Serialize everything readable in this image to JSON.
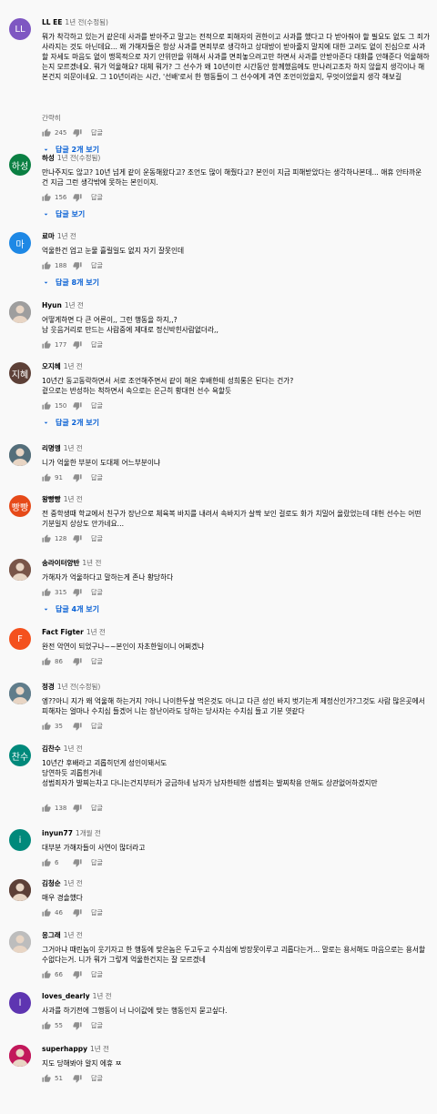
{
  "labels": {
    "reply": "답글",
    "read_more": "간략히"
  },
  "colors": {
    "link": "#065fd4",
    "text": "#030303",
    "meta": "#606060"
  },
  "comments": [
    {
      "author": "LL EE",
      "time": "1년 전(수정됨)",
      "avatar_text": "LL",
      "avatar_color": "#7e57c2",
      "avatar_icon": "",
      "text": "뭐가 착각하고 있는거 같은데 사과를 받아주고 말고는 전적으로 피해자의 권한이고 사과를 했다고 다 받아줘야 할 필요도 없도 그 죄가 사라지는 것도 아닌데요... 왜 가해자들은 항상 사과를 면죄부로 생각하고 상대방이 받아줄지 말지에 대한 고려도 없이 진심으로 사과할 자세도 마음도 없이 맹목적으로 자기 안위만을 위해서 사과를 면죄놓으려고만 하면서 사과를 안받아준다 대화를 안해준다 억울해하는지 모르겠네요. 뭐가 억울해요? 대체 뭐가? 그 선수가 왜 10년이란 시간동안 함께했음에도 만나려고조차 하지 않을지 생각이나 해본건지 의문이네요. 그 10년이라는 시간, '선배'로서 한 행동들이 그 선수에게 과연 조언이었을지, 무엇이었을지 생각 해보길",
      "likes": "245",
      "replies": "답글 2개 보기"
    },
    {
      "author": "하성",
      "time": "1년 전(수정됨)",
      "avatar_text": "하성",
      "avatar_color": "#0b8043",
      "avatar_icon": "",
      "text": "만나주지도 않고? 10년 넘게 같이 운동해왔다고? 조언도 많이 해줬다고? 본인이 지금 피해받았다는 생각하나본데... 애휴 안타까운 건 지금 그런 생각밖에 못하는 본인이지.",
      "likes": "156",
      "replies": "답글 보기"
    },
    {
      "author": "료마",
      "time": "1년 전",
      "avatar_text": "마",
      "avatar_color": "#1e88e5",
      "avatar_icon": "",
      "text": "억울한건 업고 눈물 흘릴일도 없지 자기 잘못인데",
      "likes": "188",
      "replies": "답글 8개 보기"
    },
    {
      "author": "Hyun",
      "time": "1년 전",
      "avatar_text": "",
      "avatar_color": "#9e9e9e",
      "avatar_icon": "photo-avatar",
      "text": "어떻게하면 다 큰 어른이,, 그런 행동을 하지,,?\n남 웃음거리로 만드는 사람중에 제대로 정신박힌사람없더라,,",
      "likes": "177",
      "replies": ""
    },
    {
      "author": "오지혜",
      "time": "1년 전",
      "avatar_text": "지혜",
      "avatar_color": "#5d4037",
      "avatar_icon": "",
      "text": "10년간 동고동락하면서 서로 조언해주면서 같이 해온 후배한테 성희롱은 된다는 건가?\n겉으로는 반성하는 척하면서 속으로는 은근히 황대헌 선수 욕할듯",
      "likes": "150",
      "replies": "답글 2개 보기"
    },
    {
      "author": "리명멩",
      "time": "1년 전",
      "avatar_text": "",
      "avatar_color": "#546e7a",
      "avatar_icon": "photo-avatar",
      "text": "니가 억울한 부분이 도대체 어느부분이냐",
      "likes": "91",
      "replies": ""
    },
    {
      "author": "왕빵빵",
      "time": "1년 전",
      "avatar_text": "빵빵",
      "avatar_color": "#e64a19",
      "avatar_icon": "",
      "text": "전 중학생때 학교에서 친구가 장난으로 체육복 바지를 내려서 속바지가 살짝 보인 걸로도 화가 치밀어 올랐었는데 대헌 선수는 어떤 기분일지 상상도 안가네요...",
      "likes": "128",
      "replies": ""
    },
    {
      "author": "송라이터양반",
      "time": "1년 전",
      "avatar_text": "",
      "avatar_color": "#795548",
      "avatar_icon": "photo-avatar",
      "text": "가해자가 억울하다고 말하는게 존나 황당하다",
      "likes": "315",
      "replies": "답글 4개 보기"
    },
    {
      "author": "Fact Figter",
      "time": "1년 전",
      "avatar_text": "F",
      "avatar_color": "#f4511e",
      "avatar_icon": "",
      "text": "완전 악연이 되었구나~~본인이 자초한일이니 어쩌겠냐",
      "likes": "86",
      "replies": ""
    },
    {
      "author": "정경",
      "time": "1년 전(수정됨)",
      "avatar_text": "",
      "avatar_color": "#607d8b",
      "avatar_icon": "photo-avatar",
      "text": "엥??아니 지가 왜 억울해 하는거지 ?아니 나이한두살 먹은것도 아니고 다큰 성인 바지 벗기는게 제정신인가?그것도 사람 많은곳에서 피해자는 얼마나 수치심 들겠어 니는 장난이라도 당하는 당사자는 수치심 들고 기분 엿같다",
      "likes": "35",
      "replies": ""
    },
    {
      "author": "김찬수",
      "time": "1년 전",
      "avatar_text": "찬수",
      "avatar_color": "#00897b",
      "avatar_icon": "",
      "text": "10년간 후배라고 괴롭히던게 성인이돼서도\n당연하듯 괴롭힌거네\n성범죄자가 발찌는차고 다니는건지부터가 궁금하네 남자가 남자한테한 성범죄는 발찌착용 안해도 상관없어하겠지만",
      "likes": "138",
      "replies": ""
    },
    {
      "author": "inyun77",
      "time": "1개월 전",
      "avatar_text": "i",
      "avatar_color": "#00897b",
      "avatar_icon": "",
      "text": "대부분 가해자들이 사연이 많더라고",
      "likes": "6",
      "replies": ""
    },
    {
      "author": "김청순",
      "time": "1년 전",
      "avatar_text": "",
      "avatar_color": "#5d4037",
      "avatar_icon": "photo-avatar",
      "text": "매우 경솔했다",
      "likes": "46",
      "replies": ""
    },
    {
      "author": "응그래",
      "time": "1년 전",
      "avatar_text": "",
      "avatar_color": "#bdbdbd",
      "avatar_icon": "photo-avatar",
      "text": "그거아냐 때린놈이 웃기자고 한 행동에 맞은놈은 두고두고 수치심에 방장못이루고 괴롭다는거... 말로는 용서해도 마음으로는 용서할수없다는거. 니가 뭐가 그렇게 억울한건지는 잘 모르겠네",
      "likes": "66",
      "replies": ""
    },
    {
      "author": "loves_dearly",
      "time": "1년 전",
      "avatar_text": "l",
      "avatar_color": "#5e35b1",
      "avatar_icon": "",
      "text": "사과를 하기전에 그행동이 너 나이값에 맞는 행동인지 묻고싶다.",
      "likes": "55",
      "replies": ""
    },
    {
      "author": "superhappy",
      "time": "1년 전",
      "avatar_text": "",
      "avatar_color": "#c2185b",
      "avatar_icon": "photo-avatar",
      "text": "지도 당해봐야 알지 에휴 ㅉ",
      "likes": "51",
      "replies": ""
    }
  ]
}
